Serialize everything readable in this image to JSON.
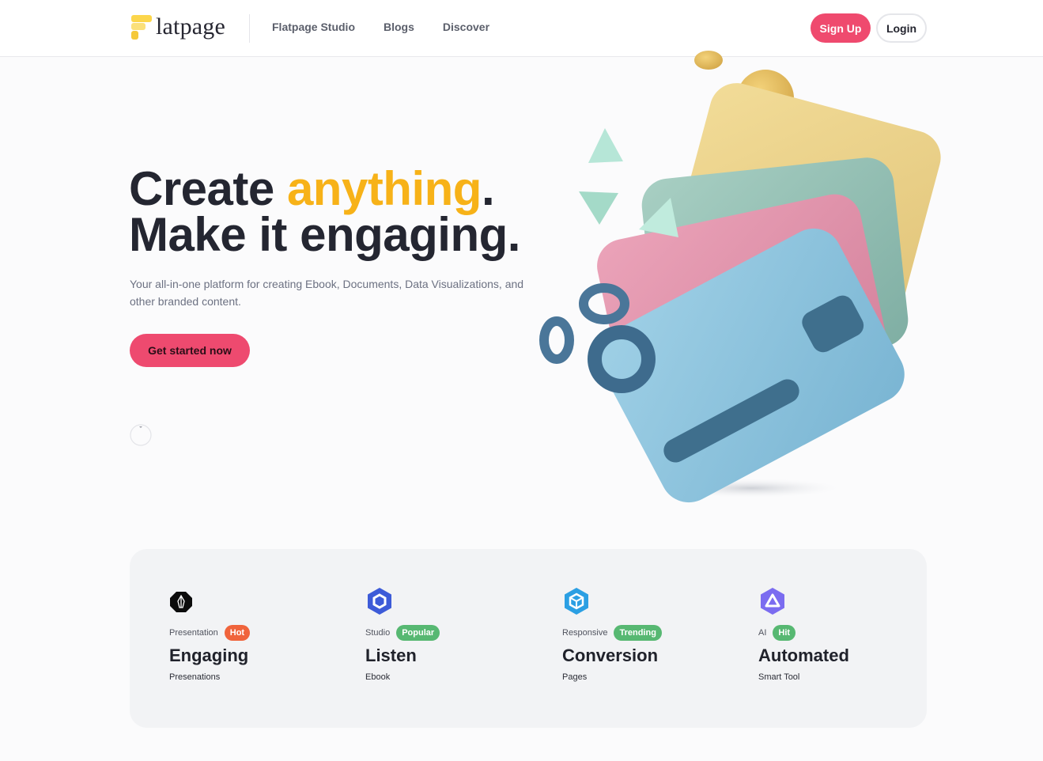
{
  "header": {
    "logo_text": "latpage",
    "nav": [
      "Flatpage Studio",
      "Blogs",
      "Discover"
    ],
    "signup_label": "Sign Up",
    "login_label": "Login"
  },
  "hero": {
    "title_part1": "Create ",
    "title_accent": "anything",
    "title_part2": ".",
    "title_line2": "Make it engaging.",
    "subtitle": "Your all-in-one platform for creating Ebook, Documents, Data Visualizations, and other branded content.",
    "cta_label": "Get started now"
  },
  "colors": {
    "accent_yellow": "#f7b218",
    "brand_pink": "#ef4a6e"
  },
  "features": [
    {
      "icon": "eos-icon",
      "category": "Presentation",
      "badge": "Hot",
      "badge_color": "#f0643c",
      "title": "Engaging",
      "desc": "Presenations"
    },
    {
      "icon": "chainlink-icon",
      "category": "Studio",
      "badge": "Popular",
      "badge_color": "#57b872",
      "title": "Listen",
      "desc": "Ebook"
    },
    {
      "icon": "cube-icon",
      "category": "Responsive",
      "badge": "Trending",
      "badge_color": "#57b872",
      "title": "Conversion",
      "desc": "Pages"
    },
    {
      "icon": "triangle-icon",
      "category": "AI",
      "badge": "Hit",
      "badge_color": "#57b872",
      "title": "Automated",
      "desc": "Smart Tool"
    }
  ]
}
